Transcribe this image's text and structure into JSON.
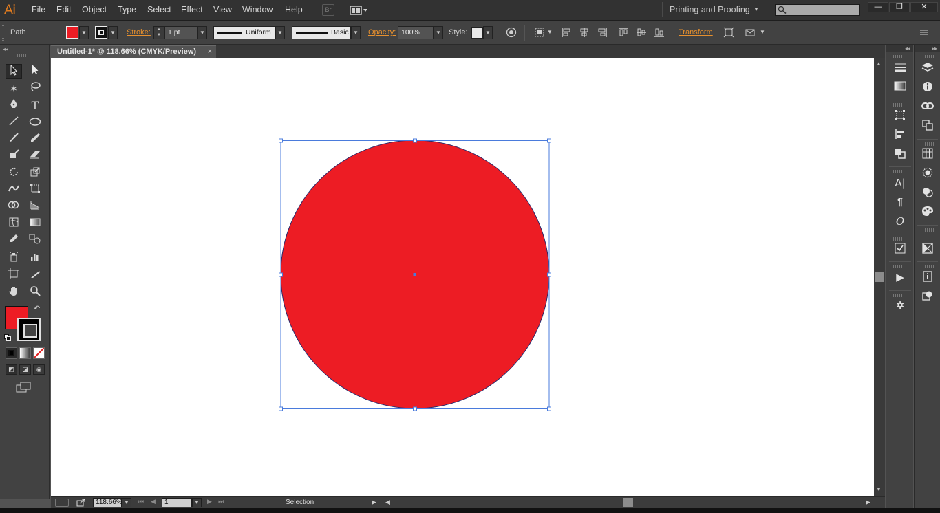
{
  "app": {
    "logo": "Ai",
    "menus": [
      "File",
      "Edit",
      "Object",
      "Type",
      "Select",
      "Effect",
      "View",
      "Window",
      "Help"
    ],
    "bridge_label": "Br",
    "workspace": "Printing and Proofing",
    "window_controls": {
      "minimize": "—",
      "restore": "❐",
      "close": "✕"
    }
  },
  "control_bar": {
    "selection_type": "Path",
    "stroke_label": "Stroke:",
    "stroke_weight": "1 pt",
    "profile_label": "Uniform",
    "brush_label": "Basic",
    "opacity_label": "Opacity:",
    "opacity_value": "100%",
    "style_label": "Style:",
    "transform_label": "Transform",
    "fill_color": "#ed1c24"
  },
  "document": {
    "tab_title": "Untitled-1* @ 118.66% (CMYK/Preview)",
    "tab_close": "×",
    "circle_fill": "#ed1c24",
    "circle_stroke": "#2b2b6b",
    "selection_color": "#4a7bdc"
  },
  "status_bar": {
    "zoom": "118.66%",
    "artboard": "1",
    "tool_name": "Selection"
  },
  "colors": {
    "fill": "#ed1c24",
    "stroke": "#000000",
    "accent": "#e7902e"
  }
}
